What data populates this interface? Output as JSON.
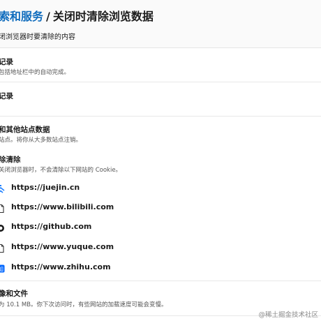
{
  "breadcrumb": {
    "parent": "索和服务",
    "separator": "/",
    "current": "关闭时清除浏览数据"
  },
  "subtitle": "闭浏览器时要清除的内容",
  "options": [
    {
      "title": "记录",
      "desc": "包括地址栏中的自动完成。"
    },
    {
      "title": "记录",
      "desc": ""
    },
    {
      "title": "和其他站点数据",
      "desc": "站点。将你从大多数站点注销。"
    }
  ],
  "clear_section": {
    "title": "除清除",
    "desc": "关闭浏览器时，不会清除以下网站的 Cookie。"
  },
  "sites": [
    {
      "url": "https://juejin.cn",
      "icon": "juejin-icon"
    },
    {
      "url": "https://www.bilibili.com",
      "icon": "page-icon"
    },
    {
      "url": "https://github.com",
      "icon": "github-icon"
    },
    {
      "url": "https://www.yuque.com",
      "icon": "page-icon"
    },
    {
      "url": "https://www.zhihu.com",
      "icon": "zhihu-icon"
    }
  ],
  "cache_option": {
    "title": "像和文件",
    "desc": "为 10.1 MB。你下次访问时，有些网站的加载速度可能会变慢。"
  },
  "watermark": "@稀土掘金技术社区",
  "colors": {
    "accent": "#0f6cbd",
    "juejin": "#1e80ff",
    "zhihu": "#0066ff"
  }
}
